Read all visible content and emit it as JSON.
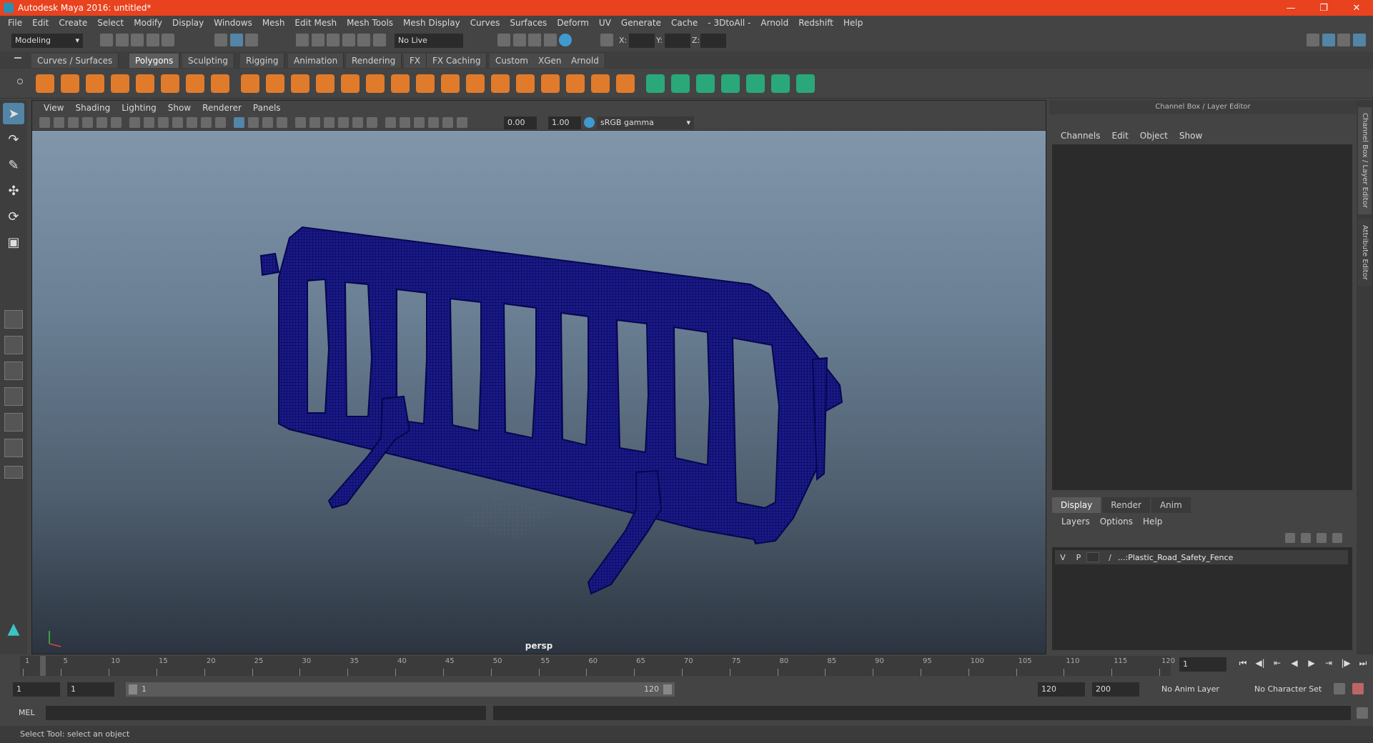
{
  "window": {
    "title": "Autodesk Maya 2016: untitled*"
  },
  "menubar": [
    "File",
    "Edit",
    "Create",
    "Select",
    "Modify",
    "Display",
    "Windows",
    "Mesh",
    "Edit Mesh",
    "Mesh Tools",
    "Mesh Display",
    "Curves",
    "Surfaces",
    "Deform",
    "UV",
    "Generate",
    "Cache",
    "- 3DtoAll -",
    "Arnold",
    "Redshift",
    "Help"
  ],
  "statusline": {
    "mode": "Modeling",
    "live_surface": "No Live Surface",
    "x_label": "X:",
    "y_label": "Y:",
    "z_label": "Z:"
  },
  "shelf_tabs": [
    "Curves / Surfaces",
    "Polygons",
    "Sculpting",
    "Rigging",
    "Animation",
    "Rendering",
    "FX",
    "FX Caching",
    "Custom",
    "XGen",
    "Arnold"
  ],
  "shelf_active": "Polygons",
  "viewport": {
    "menu": [
      "View",
      "Shading",
      "Lighting",
      "Show",
      "Renderer",
      "Panels"
    ],
    "exposure": "0.00",
    "gamma": "1.00",
    "color_space": "sRGB gamma",
    "camera_label": "persp",
    "wire_color": "#0a0a7a"
  },
  "channel_box": {
    "title": "Channel Box / Layer Editor",
    "menu": [
      "Channels",
      "Edit",
      "Object",
      "Show"
    ]
  },
  "layer_editor": {
    "tabs": [
      "Display",
      "Render",
      "Anim"
    ],
    "active_tab": "Display",
    "menu": [
      "Layers",
      "Options",
      "Help"
    ],
    "layers": [
      {
        "v": "V",
        "p": "P",
        "name": "...:Plastic_Road_Safety_Fence"
      }
    ]
  },
  "side_tabs": [
    "Channel Box / Layer Editor",
    "Attribute Editor"
  ],
  "timeline": {
    "ticks": [
      1,
      5,
      10,
      15,
      20,
      25,
      30,
      35,
      40,
      45,
      50,
      55,
      60,
      65,
      70,
      75,
      80,
      85,
      90,
      95,
      100,
      105,
      110,
      115,
      120
    ],
    "current_frame": "1"
  },
  "range": {
    "start": "1",
    "anim_start": "1",
    "slider_start": "1",
    "slider_end": "120",
    "end": "120",
    "anim_end": "200",
    "anim_layer": "No Anim Layer",
    "character_set": "No Character Set"
  },
  "command_line": {
    "label": "MEL"
  },
  "help_line": "Select Tool: select an object"
}
